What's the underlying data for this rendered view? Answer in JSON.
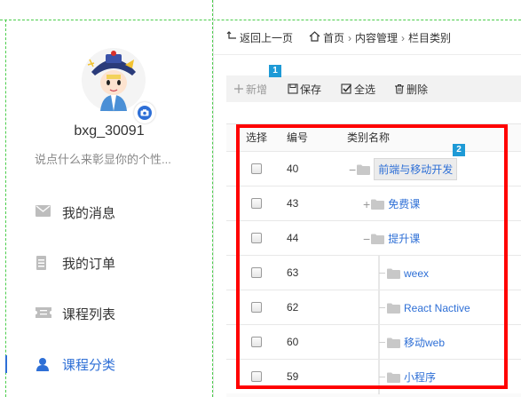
{
  "user": {
    "username": "bxg_30091",
    "motto": "说点什么来彰显你的个性..."
  },
  "nav": [
    {
      "label": "我的消息",
      "icon": "mail-icon",
      "active": false
    },
    {
      "label": "我的订单",
      "icon": "document-icon",
      "active": false
    },
    {
      "label": "课程列表",
      "icon": "ticket-icon",
      "active": false
    },
    {
      "label": "课程分类",
      "icon": "user-icon",
      "active": true
    }
  ],
  "breadcrumb": {
    "back": "返回上一页",
    "home": "首页",
    "section": "内容管理",
    "current": "栏目类别"
  },
  "toolbar": {
    "add": "新增",
    "save": "保存",
    "select_all": "全选",
    "delete": "删除"
  },
  "badges": {
    "toolbar": "1",
    "table": "2"
  },
  "table": {
    "headers": [
      "选择",
      "编号",
      "类别名称"
    ],
    "rows": [
      {
        "id": "40",
        "name": "前端与移动开发",
        "level": 0,
        "toggle": "−",
        "highlight": true
      },
      {
        "id": "43",
        "name": "免费课",
        "level": 1,
        "toggle": "+",
        "highlight": false
      },
      {
        "id": "44",
        "name": "提升课",
        "level": 1,
        "toggle": "−",
        "highlight": false
      },
      {
        "id": "63",
        "name": "weex",
        "level": 2,
        "toggle": "",
        "highlight": false
      },
      {
        "id": "62",
        "name": "React Nactive",
        "level": 2,
        "toggle": "",
        "highlight": false
      },
      {
        "id": "60",
        "name": "移动web",
        "level": 2,
        "toggle": "",
        "highlight": false
      },
      {
        "id": "59",
        "name": "小程序",
        "level": 2,
        "toggle": "",
        "highlight": false
      }
    ]
  },
  "colors": {
    "accent": "#2e6fd6",
    "highlight_box": "#ff0000",
    "badge": "#1e9ad6",
    "guides": "#4ccd4c"
  }
}
